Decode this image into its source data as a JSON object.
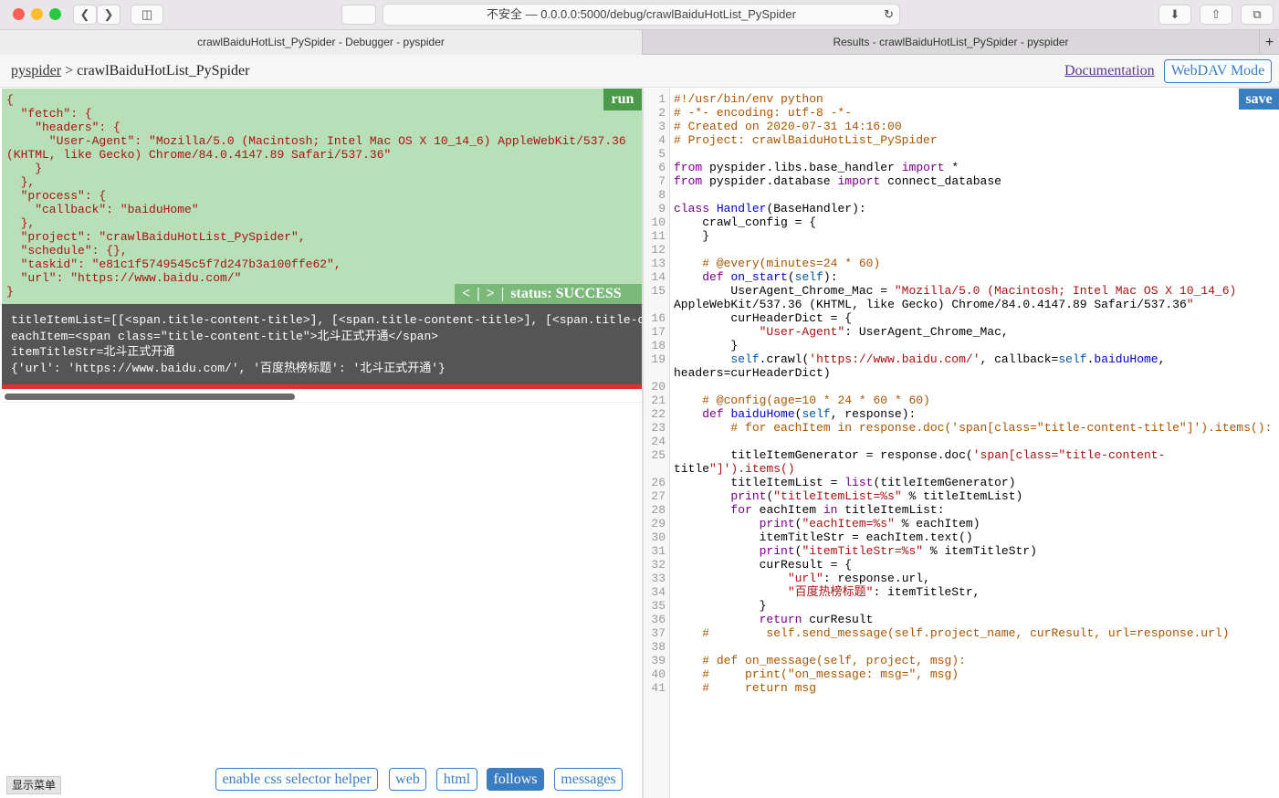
{
  "browser": {
    "address": "不安全 — 0.0.0.0:5000/debug/crawlBaiduHotList_PySpider",
    "tabs": [
      {
        "label": "crawlBaiduHotList_PySpider - Debugger - pyspider",
        "active": true
      },
      {
        "label": "Results - crawlBaiduHotList_PySpider - pyspider",
        "active": false
      }
    ],
    "new_tab_label": "+"
  },
  "header": {
    "home_link": "pyspider",
    "separator": " > ",
    "project_name": "crawlBaiduHotList_PySpider",
    "documentation_link": "Documentation",
    "webdav_button": "WebDAV Mode"
  },
  "debugger": {
    "run_button": "run",
    "request_json": "{\n  \"fetch\": {\n    \"headers\": {\n      \"User-Agent\": \"Mozilla/5.0 (Macintosh; Intel Mac OS X 10_14_6) AppleWebKit/537.36\n(KHTML, like Gecko) Chrome/84.0.4147.89 Safari/537.36\"\n    }\n  },\n  \"process\": {\n    \"callback\": \"baiduHome\"\n  },\n  \"project\": \"crawlBaiduHotList_PySpider\",\n  \"schedule\": {},\n  \"taskid\": \"e81c1f5749545c5f7d247b3a100ffe62\",\n  \"url\": \"https://www.baidu.com/\"\n}",
    "nav": {
      "prev": "<",
      "sep1": "|",
      "next": ">",
      "sep2": "|"
    },
    "status": "status: SUCCESS",
    "output_lines": "titleItemList=[[<span.title-content-title>], [<span.title-content-title>], [<span.title-content-title>]\neachItem=<span class=\"title-content-title\">北斗正式开通</span>\nitemTitleStr=北斗正式开通\n{'url': 'https://www.baidu.com/', '百度热榜标题': '北斗正式开通'}",
    "show_menu": "显示菜单",
    "panel_buttons": [
      {
        "label": "enable css selector helper",
        "active": false
      },
      {
        "label": "web",
        "active": false
      },
      {
        "label": "html",
        "active": false
      },
      {
        "label": "follows",
        "active": true
      },
      {
        "label": "messages",
        "active": false
      }
    ]
  },
  "editor": {
    "save_button": "save",
    "line_numbers": "1\n2\n3\n4\n5\n6\n7\n8\n9\n10\n11\n12\n13\n14\n15\n\n16\n17\n18\n19\n\n20\n21\n22\n23\n24\n25\n\n26\n27\n28\n29\n30\n31\n32\n33\n34\n35\n36\n37\n38\n39\n40\n41",
    "code_lines": [
      "#!/usr/bin/env python",
      "# -*- encoding: utf-8 -*-",
      "# Created on 2020-07-31 14:16:00",
      "# Project: crawlBaiduHotList_PySpider",
      "",
      "from pyspider.libs.base_handler import *",
      "from pyspider.database import connect_database",
      "",
      "class Handler(BaseHandler):",
      "    crawl_config = {",
      "    }",
      "",
      "    # @every(minutes=24 * 60)",
      "    def on_start(self):",
      "        UserAgent_Chrome_Mac = \"Mozilla/5.0 (Macintosh; Intel Mac OS X 10_14_6)",
      "AppleWebKit/537.36 (KHTML, like Gecko) Chrome/84.0.4147.89 Safari/537.36\"",
      "        curHeaderDict = {",
      "            \"User-Agent\": UserAgent_Chrome_Mac,",
      "        }",
      "        self.crawl('https://www.baidu.com/', callback=self.baiduHome,",
      "headers=curHeaderDict)",
      "",
      "    # @config(age=10 * 24 * 60 * 60)",
      "    def baiduHome(self, response):",
      "        # for eachItem in response.doc('span[class=\"title-content-title\"]').items():",
      "",
      "        titleItemGenerator = response.doc('span[class=\"title-content-",
      "title\"]').items()",
      "        titleItemList = list(titleItemGenerator)",
      "        print(\"titleItemList=%s\" % titleItemList)",
      "        for eachItem in titleItemList:",
      "            print(\"eachItem=%s\" % eachItem)",
      "            itemTitleStr = eachItem.text()",
      "            print(\"itemTitleStr=%s\" % itemTitleStr)",
      "            curResult = {",
      "                \"url\": response.url,",
      "                \"百度热榜标题\": itemTitleStr,",
      "            }",
      "            return curResult",
      "    #        self.send_message(self.project_name, curResult, url=response.url)",
      "",
      "    # def on_message(self, project, msg):",
      "    #     print(\"on_message: msg=\", msg)",
      "    #     return msg"
    ]
  },
  "colors": {
    "request_bg": "#b8e0b8",
    "run_button_bg": "#4a9a4a",
    "output_bg": "#555555",
    "error_line": "#d9342b",
    "accent_blue": "#3a7dc0",
    "comment": "#aa5500",
    "keyword": "#770088",
    "string": "#aa1111"
  }
}
